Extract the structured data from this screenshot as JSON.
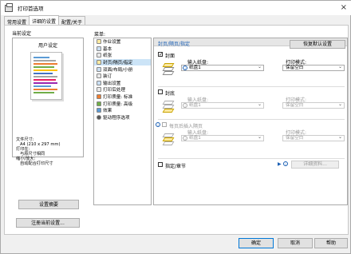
{
  "window": {
    "title": "打印首选项",
    "close_icon": "×"
  },
  "tabs": [
    "常用设置",
    "详细的设置",
    "配置/关于"
  ],
  "current_settings": {
    "label": "当前设定",
    "preview_title": "用户设定",
    "paper_size_label": "文件尺寸:",
    "paper_size_value": "A4 (210 x 297 mm)",
    "print_on_label": "打印在:",
    "print_on_value": "与原尺寸相同",
    "scaling_label": "缩小/放大:",
    "scaling_value": "自动配合打印尺寸",
    "settings_summary_btn": "设置摘要"
  },
  "register_btn": "注册当前设置...",
  "menu": {
    "label": "菜单:",
    "items": [
      "作业设置",
      "基本",
      "纸张",
      "封页/隔页/指定",
      "双面/布局/小册",
      "装订",
      "输出设置",
      "打印后处理",
      "打印质量: 标准",
      "打印质量: 高级",
      "效果",
      "驱动程序选项"
    ],
    "selected_index": 3
  },
  "content": {
    "header": "封页/隔页/指定",
    "restore_default_btn": "恢复默认设置",
    "front_cover": {
      "label": "封面",
      "checked": "✓",
      "input_tray_label": "输入纸盘:",
      "input_tray_value": "纸盘1",
      "print_mode_label": "打印模式:",
      "print_mode_value": "保留空白"
    },
    "back_cover": {
      "label": "封底",
      "input_tray_label": "输入纸盘:",
      "input_tray_value": "纸盘1",
      "print_mode_label": "打印模式:",
      "print_mode_value": "保留空白"
    },
    "slip_sheet": {
      "label": "每页后插入隔页",
      "input_tray_label": "输入纸盘:",
      "input_tray_value": "纸盘1",
      "print_mode_label": "打印模式:",
      "print_mode_value": "保留空白"
    },
    "designate": {
      "label": "指定/章节",
      "details_btn": "详细资料..."
    }
  },
  "buttons": {
    "ok": "确定",
    "cancel": "取消",
    "help": "帮助"
  }
}
